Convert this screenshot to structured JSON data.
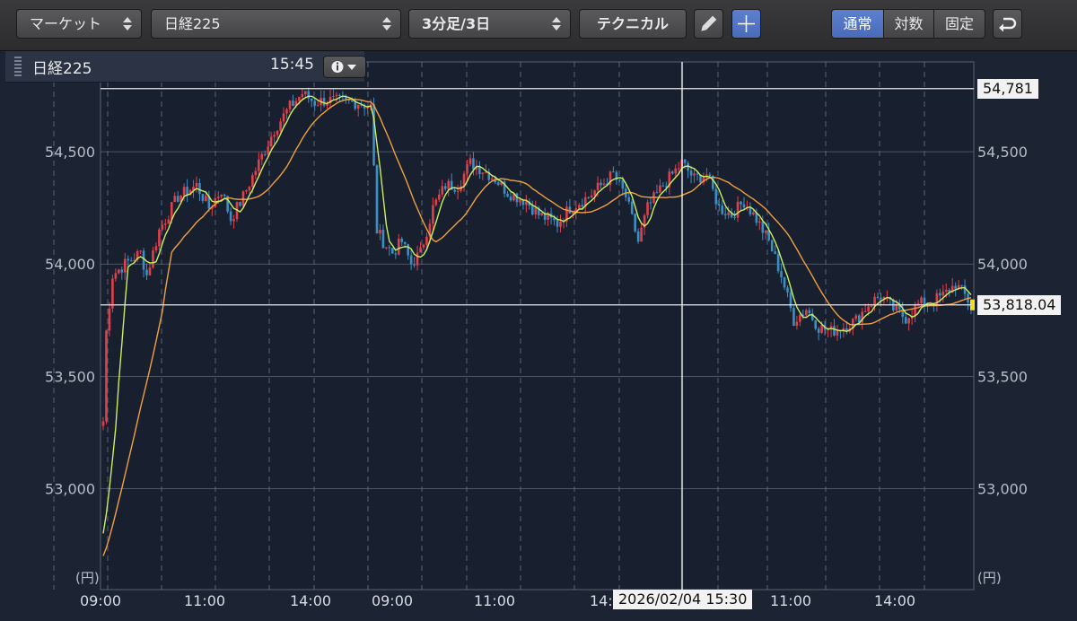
{
  "toolbar": {
    "market": "マーケット",
    "index": "日経225",
    "interval": "3分足/3日",
    "technical": "テクニカル",
    "scale_modes": [
      "通常",
      "対数",
      "固定"
    ],
    "active_scale": "通常"
  },
  "info": {
    "symbol": "日経225",
    "time": "15:45"
  },
  "colors": {
    "background": "#18202f",
    "grid": "#6b7486",
    "up": "#e0404a",
    "down": "#3b8fc4",
    "ma_short": "#c8f060",
    "ma_long": "#f0a040"
  },
  "chart_data": {
    "type": "candlestick",
    "ylim": [
      52550,
      54900
    ],
    "y_ticks": [
      53000,
      53500,
      54000,
      54500
    ],
    "y_tick_labels": [
      "53,000",
      "53,500",
      "54,000",
      "54,500"
    ],
    "y_unit": "(円)",
    "x_tick_labels": [
      "09:00",
      "11:00",
      "14:00",
      "09:00",
      "11:00",
      "14:00",
      "09:00",
      "11:00",
      "14:00"
    ],
    "crosshair_label": "2026/02/04 15:30",
    "high_line_label": "54,781",
    "last_price_label": "53,818.04",
    "high_line": 54781,
    "last_price": 53818.04,
    "price_path": [
      [
        0,
        53300
      ],
      [
        1,
        53700
      ],
      [
        3,
        53950
      ],
      [
        7,
        54000
      ],
      [
        12,
        54050
      ],
      [
        14,
        53950
      ],
      [
        18,
        54150
      ],
      [
        24,
        54300
      ],
      [
        30,
        54350
      ],
      [
        34,
        54250
      ],
      [
        38,
        54330
      ],
      [
        41,
        54200
      ],
      [
        45,
        54300
      ],
      [
        50,
        54450
      ],
      [
        55,
        54600
      ],
      [
        60,
        54700
      ],
      [
        64,
        54760
      ],
      [
        68,
        54720
      ],
      [
        72,
        54730
      ],
      [
        78,
        54720
      ],
      [
        82,
        54720
      ],
      [
        86,
        54700
      ],
      [
        88,
        54150
      ],
      [
        90,
        54100
      ],
      [
        93,
        54050
      ],
      [
        96,
        54100
      ],
      [
        99,
        54000
      ],
      [
        102,
        54050
      ],
      [
        106,
        54250
      ],
      [
        110,
        54350
      ],
      [
        114,
        54350
      ],
      [
        118,
        54450
      ],
      [
        122,
        54420
      ],
      [
        126,
        54380
      ],
      [
        130,
        54320
      ],
      [
        136,
        54280
      ],
      [
        140,
        54220
      ],
      [
        146,
        54180
      ],
      [
        150,
        54250
      ],
      [
        156,
        54300
      ],
      [
        160,
        54350
      ],
      [
        164,
        54400
      ],
      [
        168,
        54300
      ],
      [
        172,
        54100
      ],
      [
        175,
        54250
      ],
      [
        180,
        54350
      ],
      [
        186,
        54450
      ],
      [
        190,
        54380
      ],
      [
        194,
        54400
      ],
      [
        198,
        54250
      ],
      [
        202,
        54220
      ],
      [
        206,
        54280
      ],
      [
        210,
        54200
      ],
      [
        214,
        54100
      ],
      [
        218,
        53950
      ],
      [
        222,
        53750
      ],
      [
        226,
        53800
      ],
      [
        230,
        53720
      ],
      [
        234,
        53700
      ],
      [
        238,
        53720
      ],
      [
        242,
        53750
      ],
      [
        246,
        53820
      ],
      [
        250,
        53860
      ],
      [
        254,
        53800
      ],
      [
        258,
        53760
      ],
      [
        262,
        53820
      ],
      [
        266,
        53830
      ],
      [
        270,
        53860
      ],
      [
        274,
        53910
      ],
      [
        277,
        53860
      ],
      [
        279,
        53818
      ]
    ],
    "sma_short_period": 5,
    "sma_long_period": 20
  }
}
